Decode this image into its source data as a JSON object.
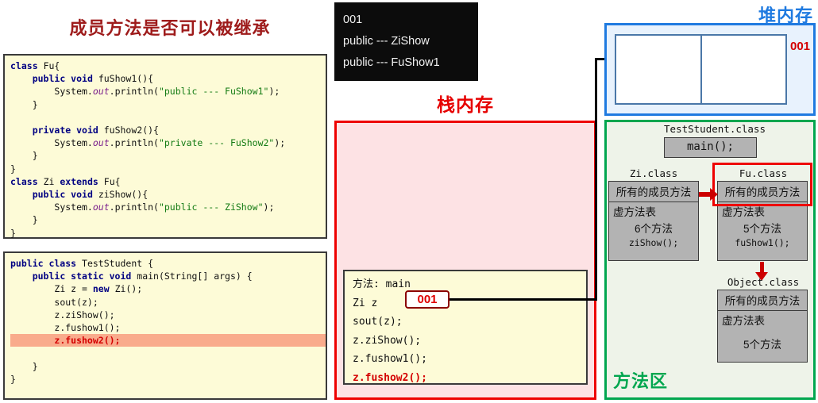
{
  "slide": {
    "title": "成员方法是否可以被继承"
  },
  "code_classes": {
    "lines": [
      "class Fu{",
      "    public void fuShow1(){",
      "        System.out.println(\"public --- FuShow1\");",
      "    }",
      "",
      "    private void fuShow2(){",
      "        System.out.println(\"private --- FuShow2\");",
      "    }",
      "}",
      "class Zi extends Fu{",
      "    public void ziShow(){",
      "        System.out.println(\"public --- ZiShow\");",
      "    }",
      "}"
    ]
  },
  "code_main": {
    "lines": [
      "public class TestStudent {",
      "    public static void main(String[] args) {",
      "        Zi z = new Zi();",
      "        sout(z);",
      "        z.ziShow();",
      "        z.fushow1();",
      "        z.fushow2();",
      "    }",
      "}"
    ],
    "highlighted_line": "z.fushow2();"
  },
  "console": {
    "lines": [
      "001",
      "public --- ZiShow",
      "public --- FuShow1"
    ]
  },
  "stack": {
    "title": "栈内存",
    "frame": {
      "header": "方法: main",
      "variable": "Zi z",
      "address": "001",
      "statements": [
        "sout(z);",
        "z.ziShow();",
        "z.fushow1();",
        "z.fushow2();"
      ],
      "highlighted_statement": "z.fushow2();"
    }
  },
  "heap": {
    "title": "堆内存",
    "object_address": "001"
  },
  "method_area": {
    "title": "方法区",
    "teststudent": {
      "label": "TestStudent.class",
      "main_method": "main();"
    },
    "zi": {
      "label": "Zi.class",
      "all_members": "所有的成员方法",
      "vtable_label": "虚方法表",
      "vtable_count": "6个方法",
      "vtable_method": "ziShow();"
    },
    "fu": {
      "label": "Fu.class",
      "all_members": "所有的成员方法",
      "vtable_label": "虚方法表",
      "vtable_count": "5个方法",
      "vtable_method": "fuShow1();"
    },
    "object": {
      "label": "Object.class",
      "all_members": "所有的成员方法",
      "vtable_label": "虚方法表",
      "vtable_count": "5个方法"
    }
  },
  "colors": {
    "title_red": "#9e1b1b",
    "stack_red": "#ee0000",
    "heap_blue": "#1f7ae0",
    "method_green": "#00a64f",
    "code_bg": "#fdfbd7",
    "highlight": "#f9ab8c"
  }
}
